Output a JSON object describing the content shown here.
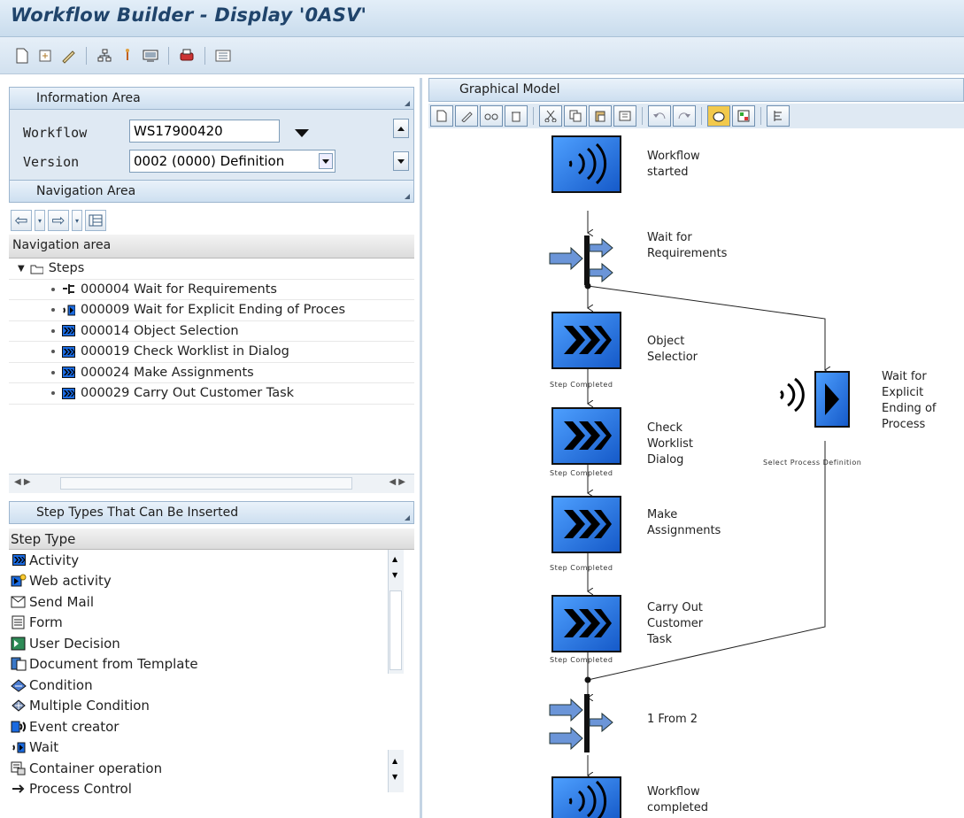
{
  "window": {
    "title": "Workflow Builder - Display '0ASV'"
  },
  "info_area": {
    "header": "Information Area",
    "workflow_label": "Workflow",
    "workflow_value": "WS17900420",
    "version_label": "Version",
    "version_value": "0002 (0000) Definition"
  },
  "nav_area": {
    "header": "Navigation Area",
    "list_header": "Navigation area",
    "root_label": "Steps",
    "items": [
      {
        "label": "000004 Wait for Requirements",
        "icon": "fork-icon"
      },
      {
        "label": "000009 Wait for Explicit Ending of Proces",
        "icon": "wait-icon"
      },
      {
        "label": "000014 Object Selection",
        "icon": "activity-icon"
      },
      {
        "label": "000019 Check Worklist in Dialog",
        "icon": "activity-icon"
      },
      {
        "label": "000024 Make Assignments",
        "icon": "activity-icon"
      },
      {
        "label": "000029 Carry Out Customer Task",
        "icon": "activity-icon"
      }
    ]
  },
  "step_types": {
    "header": "Step Types That Can Be Inserted",
    "column": "Step Type",
    "items": [
      {
        "label": "Activity",
        "icon": "activity-icon"
      },
      {
        "label": "Web activity",
        "icon": "web-activity-icon"
      },
      {
        "label": "Send Mail",
        "icon": "send-mail-icon"
      },
      {
        "label": "Form",
        "icon": "form-icon"
      },
      {
        "label": "User Decision",
        "icon": "user-decision-icon"
      },
      {
        "label": "Document from Template",
        "icon": "document-template-icon"
      },
      {
        "label": "Condition",
        "icon": "condition-icon"
      },
      {
        "label": "Multiple Condition",
        "icon": "multiple-condition-icon"
      },
      {
        "label": "Event creator",
        "icon": "event-creator-icon"
      },
      {
        "label": "Wait",
        "icon": "wait-icon"
      },
      {
        "label": "Container operation",
        "icon": "container-operation-icon"
      },
      {
        "label": "Process Control",
        "icon": "process-control-icon"
      }
    ]
  },
  "graphical_model": {
    "header": "Graphical Model",
    "nodes": {
      "start": "Workflow\nstarted",
      "fork": "Wait for\nRequirements",
      "object_selection": "Object\nSelectior",
      "check_worklist": "Check\nWorklist\nDialog",
      "make_assignments": "Make\nAssignments",
      "carry_out": "Carry Out\nCustomer\nTask",
      "wait_explicit": "Wait for\nExplicit\nEnding of\nProcess",
      "join": "1 From 2",
      "end": "Workflow\ncompleted"
    },
    "edges": {
      "step_completed": "Step Completed",
      "select_process": "Select Process Definition"
    }
  },
  "colors": {
    "step_blue": "#1a6ae0",
    "title_text": "#20446b",
    "header_bg": "#cddff0"
  }
}
